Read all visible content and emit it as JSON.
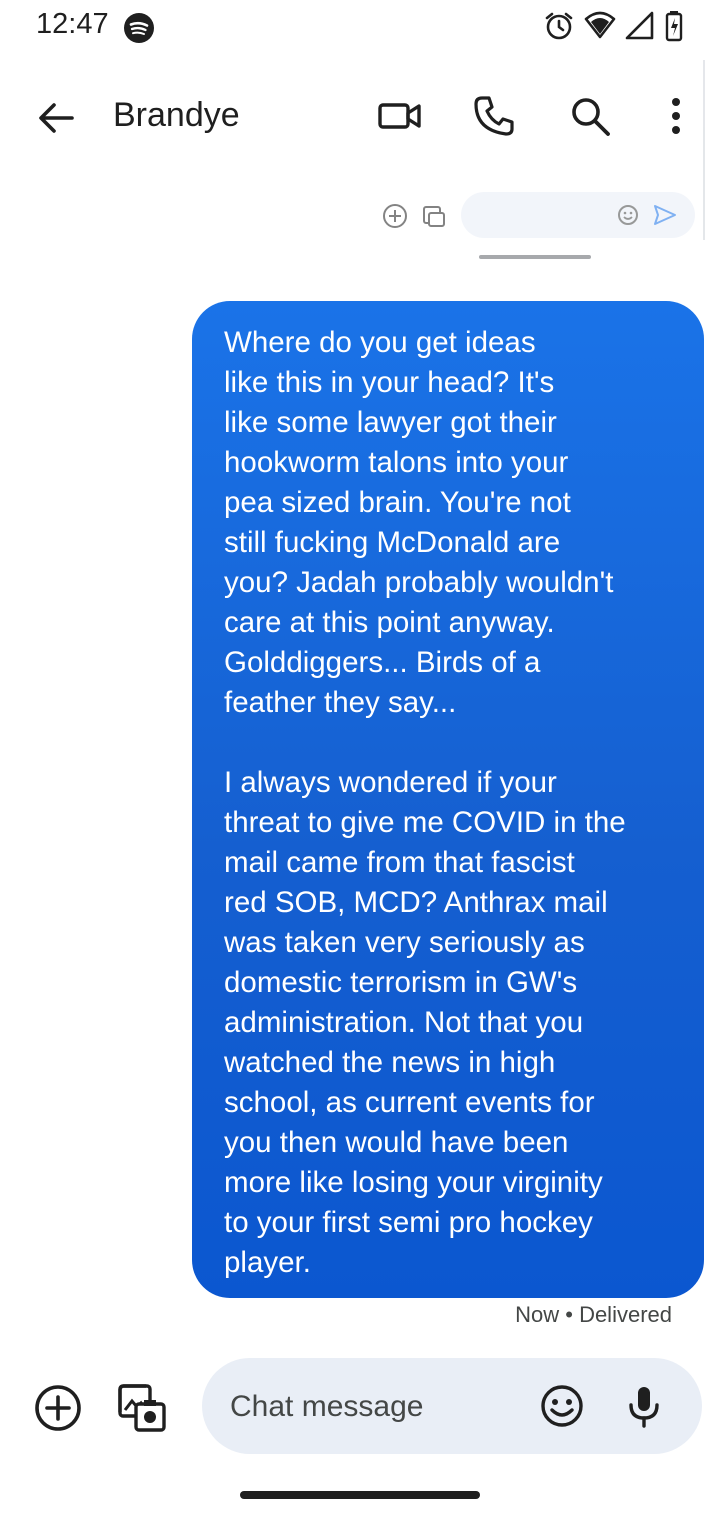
{
  "status_bar": {
    "time": "12:47",
    "icons": [
      "spotify-icon",
      "alarm-icon",
      "wifi-icon",
      "signal-icon",
      "battery-icon"
    ]
  },
  "app_bar": {
    "contact_name": "Brandye",
    "icons": [
      "back-arrow-icon",
      "video-call-icon",
      "phone-icon",
      "search-icon",
      "more-vert-icon"
    ]
  },
  "message": {
    "direction": "outgoing",
    "text": "Where do you get ideas\nlike this in your head? It's\nlike some lawyer got their\nhookworm talons into your\npea sized brain. You're not\nstill fucking McDonald are\nyou? Jadah probably wouldn't\ncare at this point anyway.\nGolddiggers... Birds of a\nfeather they say...\n\nI always wondered if your\nthreat to give me COVID in the\nmail came from that fascist\nred SOB, MCD? Anthrax mail\nwas taken very seriously as\ndomestic terrorism in GW's\nadministration. Not that you\nwatched the news in high\nschool, as current events for\nyou then would have been\nmore like losing your virginity\nto your first semi pro hockey\nplayer.",
    "status": "Now • Delivered"
  },
  "compose": {
    "placeholder": "Chat message",
    "icons": [
      "add-circle-icon",
      "gallery-icon",
      "emoji-icon",
      "mic-icon"
    ]
  },
  "colors": {
    "bubble": "#1a73e8",
    "bubble_text": "#ffffff",
    "compose_bg": "#e9eef6",
    "text": "#1f1f1f"
  }
}
